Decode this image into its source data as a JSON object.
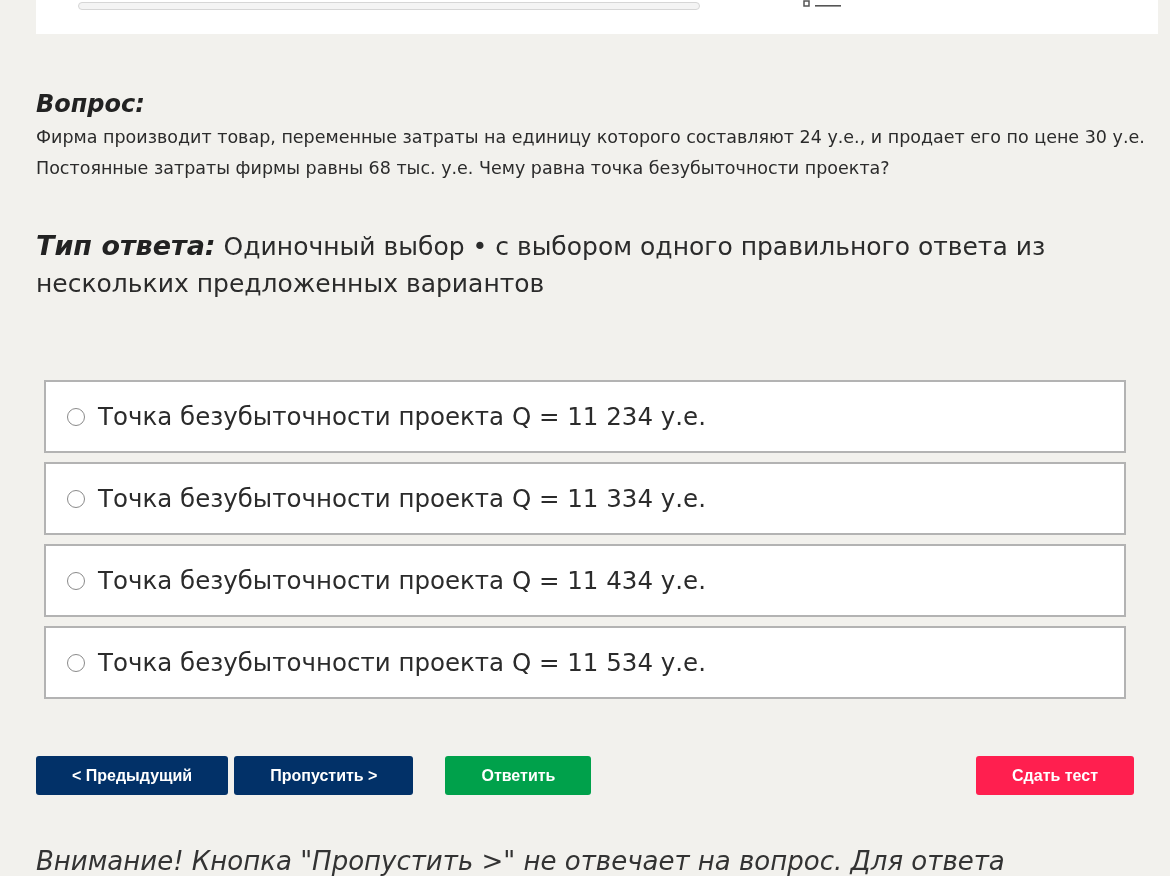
{
  "top_bar": {
    "progress": {
      "level": 0
    }
  },
  "question": {
    "heading": "Вопрос:",
    "text": "Фирма производит товар, переменные затраты на единицу которого составляют 24 у.е., и продает его по цене 30 у.е. Постоянные затраты фирмы равны 68 тыс. у.е. Чему равна точка безубыточности проекта?"
  },
  "answer_type": {
    "label": "Тип ответа:",
    "value": "Одиночный выбор • с выбором одного правильного ответа из нескольких предложенных вариантов"
  },
  "options": [
    {
      "text": "Точка безубыточности проекта Q = 11 234 у.е.",
      "selected": false
    },
    {
      "text": "Точка безубыточности проекта Q = 11 334 у.е.",
      "selected": false
    },
    {
      "text": "Точка безубыточности проекта Q = 11 434 у.е.",
      "selected": false
    },
    {
      "text": "Точка безубыточности проекта Q = 11 534 у.е.",
      "selected": false
    }
  ],
  "buttons": [
    {
      "label": "< Предыдущий",
      "kind": "nav"
    },
    {
      "label": "Пропустить >",
      "kind": "nav"
    },
    {
      "label": "Ответить",
      "kind": "answer"
    },
    {
      "label": "Сдать тест",
      "kind": "submit"
    }
  ],
  "notice": "Внимание! Кнопка \"Пропустить >\" не отвечает на вопрос. Для ответа"
}
